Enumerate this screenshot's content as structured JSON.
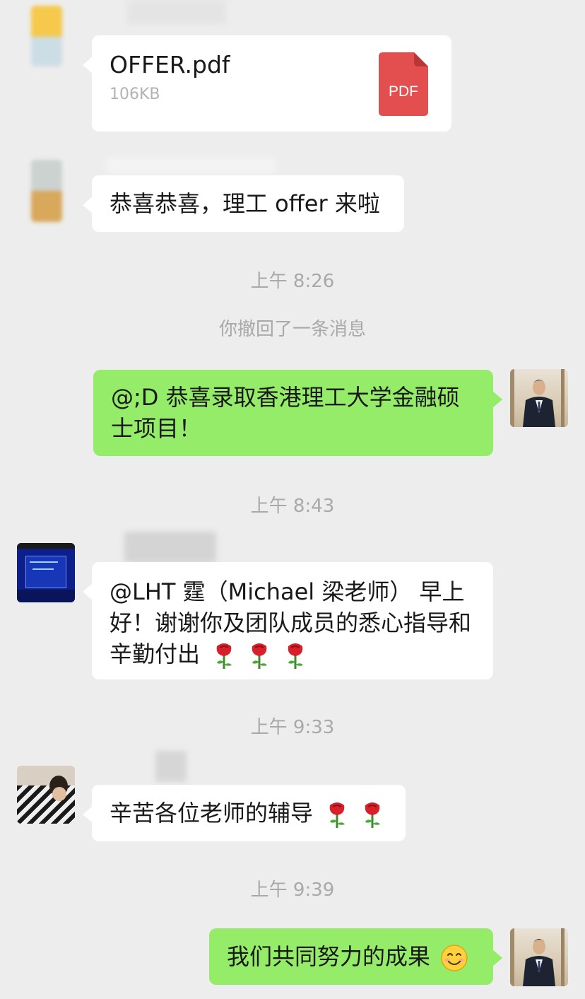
{
  "messages": {
    "file": {
      "name": "OFFER.pdf",
      "size": "106KB",
      "badge": "PDF",
      "badge_color": "#e34e4e"
    },
    "congrats": {
      "text": "恭喜恭喜，理工 offer 来啦"
    },
    "time_1": "上午 8:26",
    "system_recall": "你撤回了一条消息",
    "admission": {
      "text": "@;D 恭喜录取香港理工大学金融硕士项目！"
    },
    "time_2": "上午 8:43",
    "thanks": {
      "text": "@LHT 霆（Michael 梁老师） 早上好！谢谢你及团队成员的悉心指导和辛勤付出",
      "emoji": "rose"
    },
    "time_3": "上午 9:33",
    "hardwork": {
      "text": "辛苦各位老师的辅导",
      "emoji": "rose"
    },
    "time_4": "上午 9:39",
    "result": {
      "text": "我们共同努力的成果",
      "emoji": "smiling-face"
    }
  },
  "colors": {
    "background": "#ededed",
    "self_bubble": "#95ec69",
    "other_bubble": "#ffffff",
    "timestamp": "#a9a9a9"
  }
}
